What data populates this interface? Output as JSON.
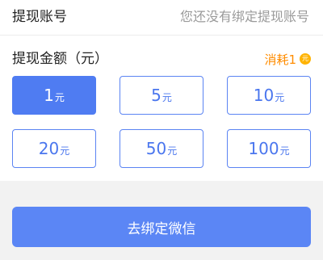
{
  "account": {
    "label": "提现账号",
    "value": "您还没有绑定提现账号"
  },
  "amount": {
    "label": "提现金额（元）",
    "cost_label": "消耗1",
    "coin_glyph": "元",
    "unit": "元",
    "options": [
      {
        "value": "1",
        "selected": true
      },
      {
        "value": "5",
        "selected": false
      },
      {
        "value": "10",
        "selected": false
      },
      {
        "value": "20",
        "selected": false
      },
      {
        "value": "50",
        "selected": false
      },
      {
        "value": "100",
        "selected": false
      }
    ]
  },
  "bind_button_label": "去绑定微信",
  "colors": {
    "accent": "#4f7cf2",
    "cost": "#ff8c00",
    "coin": "#ffb300"
  }
}
